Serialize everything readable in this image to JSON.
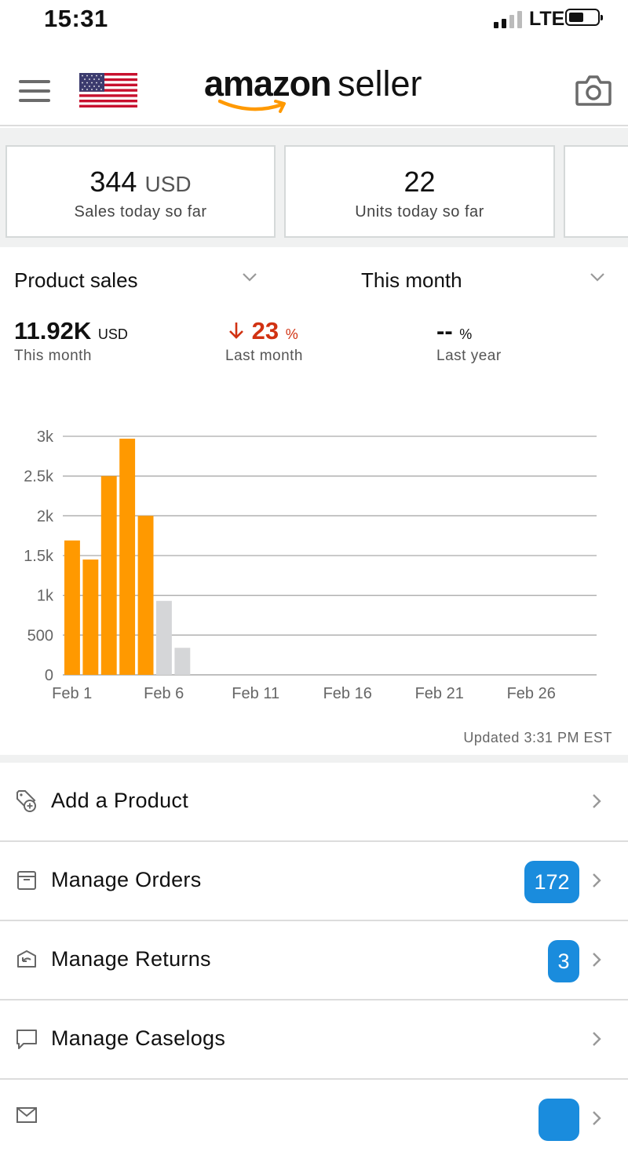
{
  "status_bar": {
    "time": "15:31",
    "network": "LTE",
    "icons": [
      "signal-icon",
      "battery-icon"
    ]
  },
  "header": {
    "logo_brand": "amazon",
    "logo_product": "seller",
    "icons": [
      "hamburger-menu-icon",
      "us-flag-icon",
      "camera-icon"
    ]
  },
  "metric_cards": [
    {
      "value": "344",
      "unit": "USD",
      "label": "Sales today so far"
    },
    {
      "value": "22",
      "unit": "",
      "label": "Units today so far"
    }
  ],
  "summary": {
    "metric_selector": "Product sales",
    "period_selector": "This month",
    "current": {
      "value": "11.92K",
      "unit": "USD",
      "label": "This month"
    },
    "vs_last_month": {
      "value": "23",
      "unit": "%",
      "label": "Last month",
      "direction": "down"
    },
    "vs_last_year": {
      "value": "--",
      "unit": "%",
      "label": "Last year"
    }
  },
  "chart_data": {
    "type": "bar",
    "title": "",
    "xlabel": "",
    "ylabel": "",
    "ylim": [
      0,
      3000
    ],
    "y_ticks": [
      "0",
      "500",
      "1k",
      "1.5k",
      "2k",
      "2.5k",
      "3k"
    ],
    "y_tick_values": [
      0,
      500,
      1000,
      1500,
      2000,
      2500,
      3000
    ],
    "x_tick_labels": [
      "Feb 1",
      "Feb 6",
      "Feb 11",
      "Feb 16",
      "Feb 21",
      "Feb 26"
    ],
    "x_tick_days": [
      1,
      6,
      11,
      16,
      21,
      26
    ],
    "x_days": [
      1,
      2,
      3,
      4,
      5,
      6,
      7
    ],
    "values": [
      1690,
      1450,
      2500,
      2970,
      2000,
      930,
      340
    ],
    "colors": [
      "#ff9900",
      "#ff9900",
      "#ff9900",
      "#ff9900",
      "#ff9900",
      "#d5d6d8",
      "#d5d6d8"
    ],
    "grid": true
  },
  "updated_text": "Updated 3:31 PM EST",
  "menu": [
    {
      "label": "Add a Product",
      "icon": "tag-plus-icon",
      "badge": ""
    },
    {
      "label": "Manage Orders",
      "icon": "box-icon",
      "badge": "172"
    },
    {
      "label": "Manage Returns",
      "icon": "return-box-icon",
      "badge": "3"
    },
    {
      "label": "Manage Caselogs",
      "icon": "chat-bubble-icon",
      "badge": ""
    }
  ],
  "colors": {
    "accent": "#ff9900",
    "badge": "#1a8cdd",
    "negative": "#d13212",
    "future_bar": "#d5d6d8"
  }
}
